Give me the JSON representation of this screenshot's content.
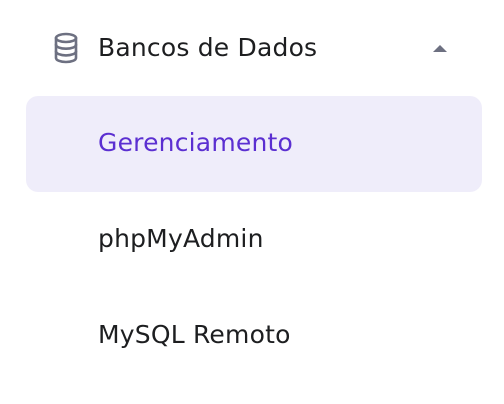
{
  "section": {
    "label": "Bancos de Dados",
    "icon": "database-icon",
    "expanded_icon": "caret-up-icon"
  },
  "items": [
    {
      "label": "Gerenciamento",
      "active": true
    },
    {
      "label": "phpMyAdmin",
      "active": false
    },
    {
      "label": "MySQL Remoto",
      "active": false
    }
  ],
  "colors": {
    "active_text": "#5b2fd1",
    "active_background": "#efedfa",
    "text": "#1d1e20",
    "icon": "#6d7081"
  }
}
